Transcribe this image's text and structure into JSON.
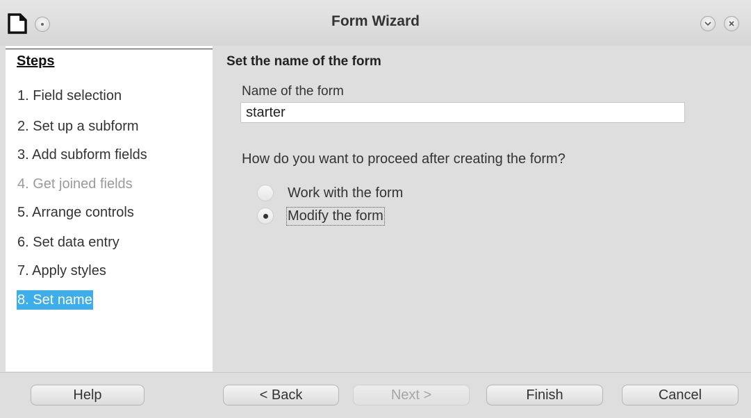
{
  "window": {
    "title": "Form Wizard",
    "app_icon": "document-icon",
    "menu_icon": "window-menu-icon",
    "minimize_icon": "minimize-icon",
    "close_icon": "close-icon"
  },
  "sidebar": {
    "heading": "Steps",
    "steps": [
      {
        "label": "1. Field selection",
        "state": "normal"
      },
      {
        "label": "2. Set up a subform",
        "state": "normal"
      },
      {
        "label": "3. Add subform fields",
        "state": "normal"
      },
      {
        "label": "4. Get joined fields",
        "state": "disabled"
      },
      {
        "label": "5. Arrange controls",
        "state": "normal"
      },
      {
        "label": "6. Set data entry",
        "state": "normal"
      },
      {
        "label": "7. Apply styles",
        "state": "normal"
      },
      {
        "label": "8. Set name",
        "state": "active"
      }
    ]
  },
  "main": {
    "heading": "Set the name of the form",
    "name_label": "Name of the form",
    "name_value": "starter",
    "question": "How do you want to proceed after creating the form?",
    "options": [
      {
        "label": "Work with the form",
        "checked": false
      },
      {
        "label": "Modify the form",
        "checked": true
      }
    ]
  },
  "footer": {
    "help": "Help",
    "back": "< Back",
    "next": "Next >",
    "finish": "Finish",
    "cancel": "Cancel"
  },
  "colors": {
    "selection": "#3daee9",
    "background": "#dedede",
    "panel": "#ffffff"
  }
}
